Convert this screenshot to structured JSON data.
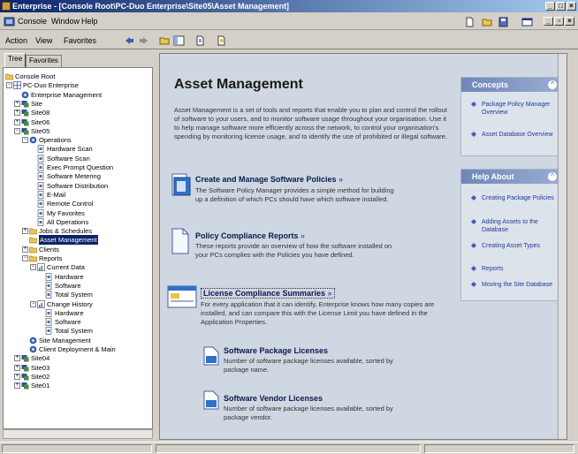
{
  "window": {
    "title": "Enterprise - [Console Root\\PC-Duo Enterprise\\Site05\\Asset Management]"
  },
  "menubar": {
    "console": "Console",
    "window": "Window",
    "help": "Help"
  },
  "toolbar": {
    "action": "Action",
    "view": "View",
    "favorites": "Favorites"
  },
  "tabs": {
    "tree": "Tree",
    "favorites": "Favorites"
  },
  "tree": [
    {
      "label": "Console Root",
      "depth": 0,
      "exp": "",
      "icon": "folder"
    },
    {
      "label": "PC-Duo Enterprise",
      "depth": 1,
      "exp": "-",
      "icon": "grid"
    },
    {
      "label": "Enterprise Management",
      "depth": 2,
      "exp": "",
      "icon": "gear"
    },
    {
      "label": "Site",
      "depth": 2,
      "exp": "+",
      "icon": "site"
    },
    {
      "label": "Site08",
      "depth": 2,
      "exp": "+",
      "icon": "site"
    },
    {
      "label": "Site06",
      "depth": 2,
      "exp": "+",
      "icon": "site"
    },
    {
      "label": "Site05",
      "depth": 2,
      "exp": "-",
      "icon": "site"
    },
    {
      "label": "Operations",
      "depth": 3,
      "exp": "-",
      "icon": "gear"
    },
    {
      "label": "Hardware Scan",
      "depth": 4,
      "exp": "",
      "icon": "doc"
    },
    {
      "label": "Software Scan",
      "depth": 4,
      "exp": "",
      "icon": "doc"
    },
    {
      "label": "Exec Prompt Question",
      "depth": 4,
      "exp": "",
      "icon": "doc"
    },
    {
      "label": "Software Metering",
      "depth": 4,
      "exp": "",
      "icon": "doc"
    },
    {
      "label": "Software Distribution",
      "depth": 4,
      "exp": "",
      "icon": "doc"
    },
    {
      "label": "E-Mail",
      "depth": 4,
      "exp": "",
      "icon": "doc"
    },
    {
      "label": "Remote Control",
      "depth": 4,
      "exp": "",
      "icon": "doc"
    },
    {
      "label": "My Favorites",
      "depth": 4,
      "exp": "",
      "icon": "doc"
    },
    {
      "label": "All Operations",
      "depth": 4,
      "exp": "",
      "icon": "doc"
    },
    {
      "label": "Jobs & Schedules",
      "depth": 3,
      "exp": "+",
      "icon": "folder"
    },
    {
      "label": "Asset Management",
      "depth": 3,
      "exp": "",
      "icon": "folder",
      "selected": true
    },
    {
      "label": "Clients",
      "depth": 3,
      "exp": "+",
      "icon": "folder"
    },
    {
      "label": "Reports",
      "depth": 3,
      "exp": "-",
      "icon": "folder"
    },
    {
      "label": "Current Data",
      "depth": 4,
      "exp": "-",
      "icon": "chart"
    },
    {
      "label": "Hardware",
      "depth": 5,
      "exp": "",
      "icon": "doc"
    },
    {
      "label": "Software",
      "depth": 5,
      "exp": "",
      "icon": "doc"
    },
    {
      "label": "Total System",
      "depth": 5,
      "exp": "",
      "icon": "doc"
    },
    {
      "label": "Change History",
      "depth": 4,
      "exp": "-",
      "icon": "chart"
    },
    {
      "label": "Hardware",
      "depth": 5,
      "exp": "",
      "icon": "doc"
    },
    {
      "label": "Software",
      "depth": 5,
      "exp": "",
      "icon": "doc"
    },
    {
      "label": "Total System",
      "depth": 5,
      "exp": "",
      "icon": "doc"
    },
    {
      "label": "Site Management",
      "depth": 3,
      "exp": "",
      "icon": "gear"
    },
    {
      "label": "Client Deployment & Main",
      "depth": 3,
      "exp": "",
      "icon": "gear"
    },
    {
      "label": "Site04",
      "depth": 2,
      "exp": "+",
      "icon": "site"
    },
    {
      "label": "Site03",
      "depth": 2,
      "exp": "+",
      "icon": "site"
    },
    {
      "label": "Site02",
      "depth": 2,
      "exp": "+",
      "icon": "site"
    },
    {
      "label": "Site01",
      "depth": 2,
      "exp": "+",
      "icon": "site"
    }
  ],
  "main": {
    "title": "Asset Management",
    "intro": "Asset Management is a set of tools and reports that enable you to plan and control the rollout of software to your users, and to monitor software usage throughout your organisation. Use it to help manage software more efficiently across the network, to control your organisation's spending by monitoring license usage, and to identify the use of prohibited or illegal software.",
    "sections": [
      {
        "title": "Create and Manage Software Policies",
        "desc": "The Software Policy Manager provides a simple method for building up a definition of which PCs should have which software installed."
      },
      {
        "title": "Policy Compliance Reports",
        "desc": "These reports provide an overview of how the software installed on your PCs complies with the Policies you have defined."
      },
      {
        "title": "License Compliance Summaries",
        "desc": "For every application that it can identify, Enterprise knows how many copies are installed, and can compare this with the License Limit you have defined in the Application Properties."
      },
      {
        "title": "Software Package Licenses",
        "desc": "Number of software package licenses available, sorted by package name."
      },
      {
        "title": "Software Vendor Licenses",
        "desc": "Number of software package licenses available, sorted by package vendor."
      }
    ],
    "arrow": "»"
  },
  "concepts": {
    "title": "Concepts",
    "items": [
      "Package Policy Manager Overview",
      "Asset Database Overview"
    ]
  },
  "help": {
    "title": "Help About",
    "items": [
      "Creating Package Policies",
      "Adding Assets to the Database",
      "Creating Asset Types",
      "Reports",
      "Moving the Site Database"
    ]
  }
}
